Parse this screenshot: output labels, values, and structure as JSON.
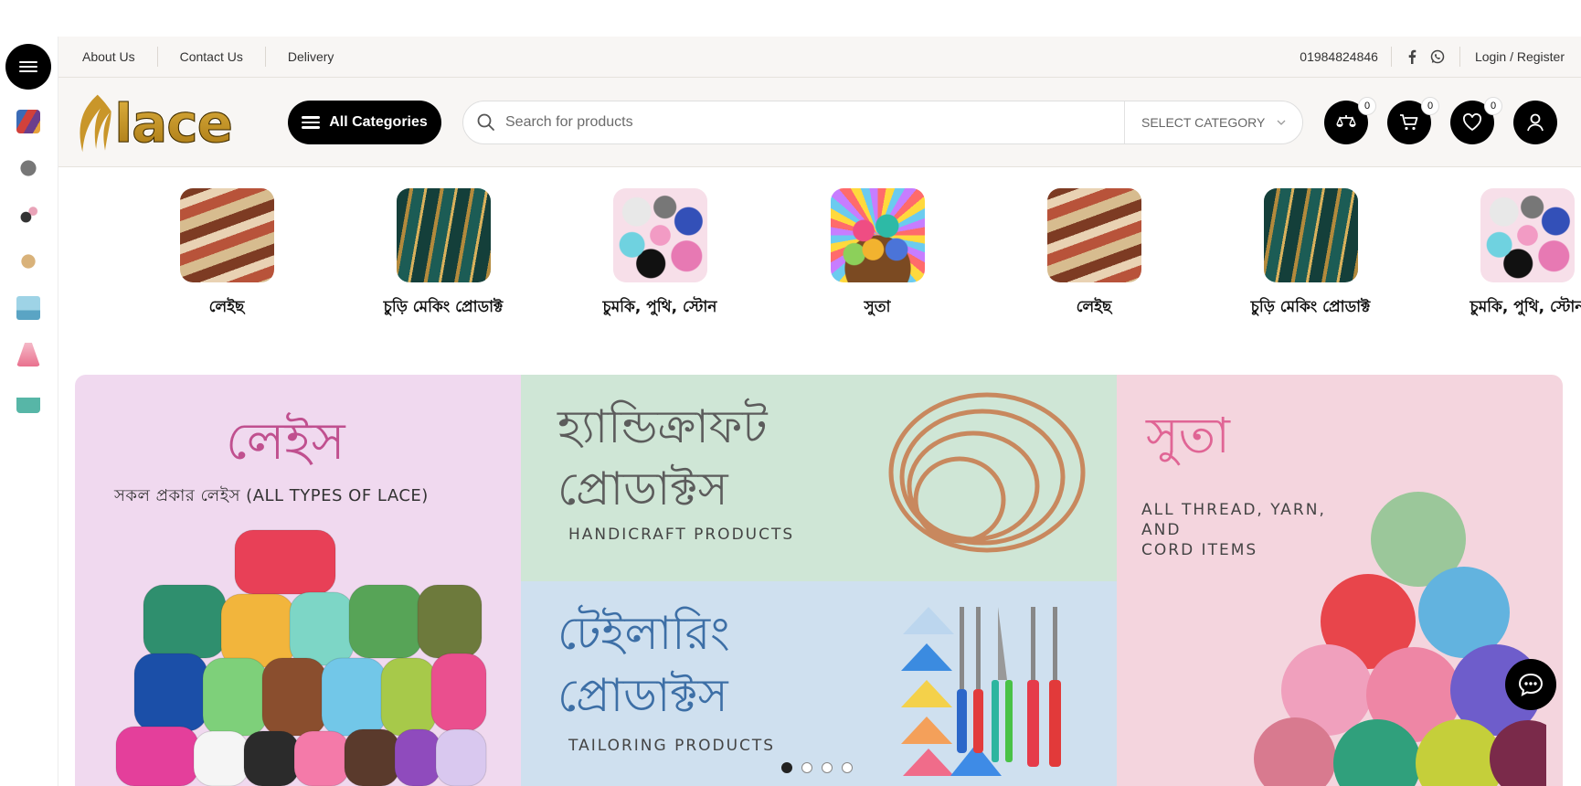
{
  "topbar": {
    "links": [
      {
        "label": "About Us"
      },
      {
        "label": "Contact Us"
      },
      {
        "label": "Delivery"
      }
    ],
    "phone": "01984824846",
    "login_label": "Login / Register"
  },
  "header": {
    "logo_text": "lace",
    "all_categories_label": "All Categories",
    "search": {
      "placeholder": "Search for products",
      "category_select": "SELECT CATEGORY"
    },
    "compare_count": "0",
    "cart_count": "0",
    "wishlist_count": "0"
  },
  "categories": [
    {
      "label": "লেইছ"
    },
    {
      "label": "চুড়ি মেকিং প্রোডাক্ট"
    },
    {
      "label": "চুমকি, পুথি, স্টোন"
    },
    {
      "label": "সুতা"
    },
    {
      "label": "লেইছ"
    },
    {
      "label": "চুড়ি মেকিং প্রোডাক্ট"
    },
    {
      "label": "চুমকি, পুথি, স্টোন"
    }
  ],
  "banners": {
    "lace": {
      "title": "লেইস",
      "subtitle": "সকল প্রকার লেইস (ALL TYPES OF LACE)"
    },
    "handicraft": {
      "title_line1": "হ্যান্ডিক্রাফট",
      "title_line2": "প্রোডাক্টস",
      "caption": "HANDICRAFT PRODUCTS"
    },
    "tailoring": {
      "title_line1": "টেইলারিং",
      "title_line2": "প্রোডাক্টস",
      "caption": "TAILORING PRODUCTS"
    },
    "suta": {
      "title": "সুতা",
      "caption_line1": "ALL THREAD, YARN,",
      "caption_line2": "AND",
      "caption_line3": "CORD ITEMS"
    }
  },
  "slider": {
    "dot_count": 4,
    "active_index": 0
  },
  "colors": {
    "accent": "#000000",
    "lace_bg": "#f0d9ef",
    "handicraft_bg": "#cfe6d6",
    "tailoring_bg": "#cfe0ef",
    "suta_bg": "#f4d5de",
    "lace_title": "#c0508f",
    "handicraft_title": "#5c5c5c",
    "tailoring_title": "#3d6fa6",
    "suta_title": "#e06595"
  }
}
